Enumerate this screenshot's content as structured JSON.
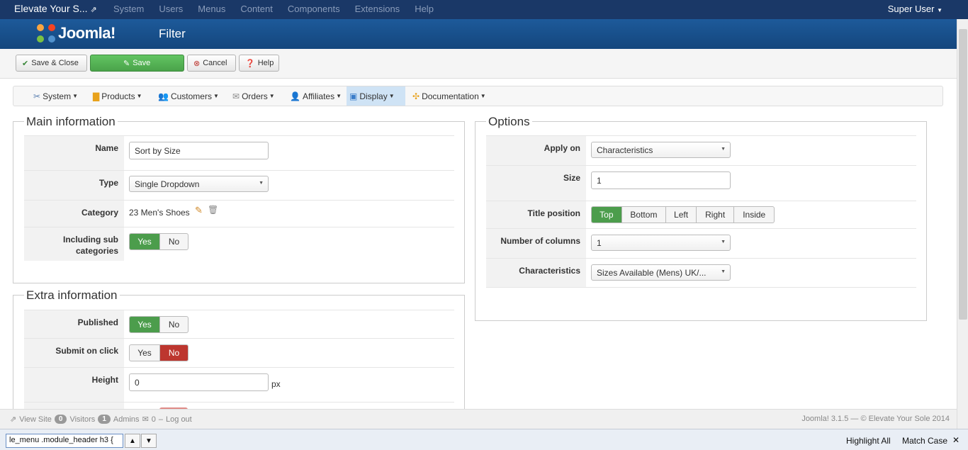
{
  "topbar": {
    "site_title": "Elevate Your S...",
    "menu": [
      "System",
      "Users",
      "Menus",
      "Content",
      "Components",
      "Extensions",
      "Help"
    ],
    "user": "Super User"
  },
  "header": {
    "logo_text": "Joomla!",
    "page_title": "Filter"
  },
  "toolbar": {
    "save_close": "Save & Close",
    "save": "Save",
    "cancel": "Cancel",
    "help": "Help"
  },
  "submenu": [
    "System",
    "Products",
    "Customers",
    "Orders",
    "Affiliates",
    "Display",
    "Documentation"
  ],
  "main_info": {
    "legend": "Main information",
    "name_label": "Name",
    "name_value": "Sort by Size",
    "type_label": "Type",
    "type_value": "Single Dropdown",
    "category_label": "Category",
    "category_value": "23 Men's Shoes",
    "sub_label": "Including sub categories",
    "yes": "Yes",
    "no": "No"
  },
  "extra_info": {
    "legend": "Extra information",
    "published_label": "Published",
    "submit_label": "Submit on click",
    "height_label": "Height",
    "height_value": "0",
    "height_unit": "px",
    "yes": "Yes",
    "no": "No"
  },
  "options": {
    "legend": "Options",
    "apply_label": "Apply on",
    "apply_value": "Characteristics",
    "size_label": "Size",
    "size_value": "1",
    "title_pos_label": "Title position",
    "title_pos_options": [
      "Top",
      "Bottom",
      "Left",
      "Right",
      "Inside"
    ],
    "title_pos_selected": "Top",
    "columns_label": "Number of columns",
    "columns_value": "1",
    "char_label": "Characteristics",
    "char_value": "Sizes Available (Mens) UK/..."
  },
  "status": {
    "view_site": "View Site",
    "visitors_count": "0",
    "visitors": "Visitors",
    "admins_count": "1",
    "admins": "Admins",
    "messages": "0",
    "logout": "Log out",
    "footer": "Joomla! 3.1.5 — © Elevate Your Sole 2014"
  },
  "findbar": {
    "query": "le_menu .module_header h3 {",
    "highlight_all": "Highlight All",
    "match_case": "Match Case"
  },
  "colors": {
    "topbar": "#1a3867",
    "header": "#1d5a9a",
    "green": "#4c9d4c",
    "red": "#bd362f"
  }
}
